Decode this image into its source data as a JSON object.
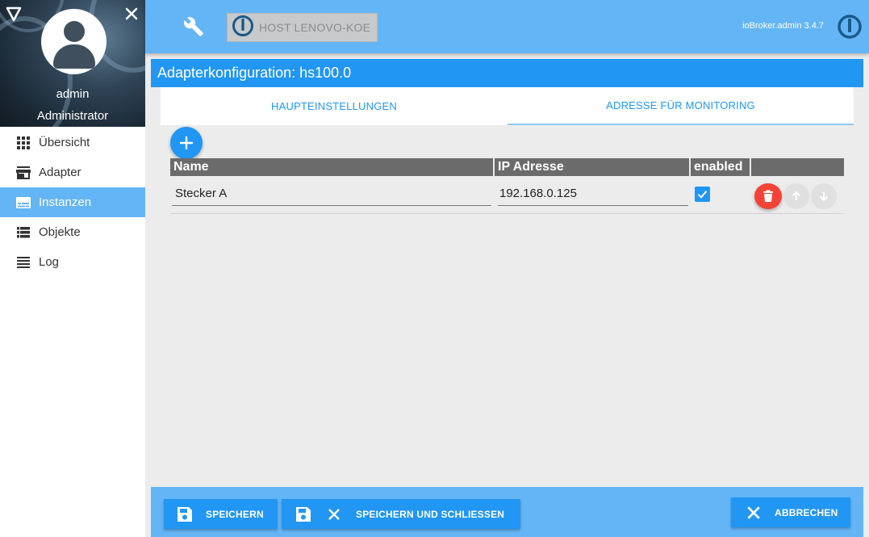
{
  "sidebar": {
    "user_name": "admin",
    "user_role": "Administrator",
    "items": [
      {
        "label": "Übersicht",
        "icon": "grid-icon",
        "active": false
      },
      {
        "label": "Adapter",
        "icon": "store-icon",
        "active": false
      },
      {
        "label": "Instanzen",
        "icon": "subtitles-icon",
        "active": true
      },
      {
        "label": "Objekte",
        "icon": "view-list-icon",
        "active": false
      },
      {
        "label": "Log",
        "icon": "lines-icon",
        "active": false
      }
    ]
  },
  "topbar": {
    "host_label": "HOST LENOVO-KOE",
    "version": "ioBroker.admin 3.4.7"
  },
  "panel": {
    "title": "Adapterkonfiguration: hs100.0",
    "tabs": [
      {
        "label": "HAUPTEINSTELLUNGEN",
        "active": false
      },
      {
        "label": "ADRESSE FÜR MONITORING",
        "active": true
      }
    ]
  },
  "table": {
    "headers": [
      "Name",
      "IP Adresse",
      "enabled",
      ""
    ],
    "rows": [
      {
        "name": "Stecker A",
        "ip": "192.168.0.125",
        "enabled": true
      }
    ]
  },
  "footer": {
    "save_label": "SPEICHERN",
    "save_close_label": "SPEICHERN UND SCHLIESSEN",
    "cancel_label": "ABBRECHEN"
  },
  "colors": {
    "primary": "#2196f3",
    "topbar": "#64b5f6",
    "danger": "#f44336",
    "table_header": "#6b6b6b"
  }
}
